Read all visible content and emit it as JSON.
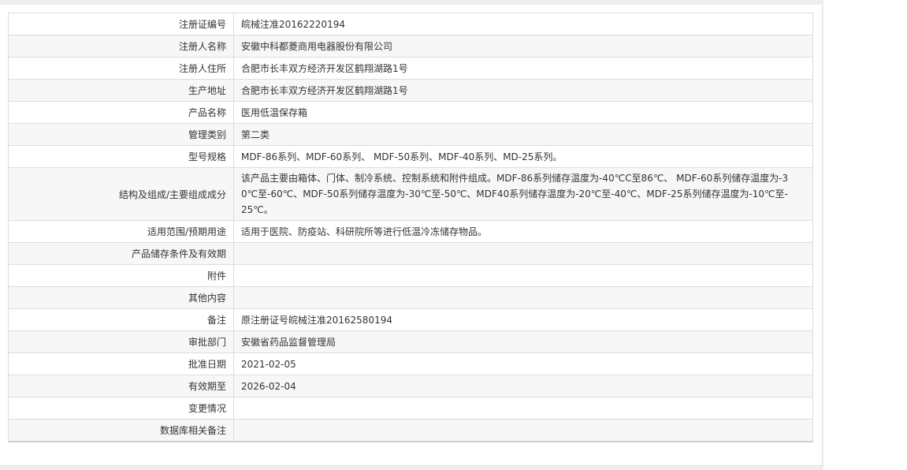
{
  "rows": [
    {
      "label": "注册证编号",
      "value": "皖械注准20162220194"
    },
    {
      "label": "注册人名称",
      "value": "安徽中科都菱商用电器股份有限公司"
    },
    {
      "label": "注册人住所",
      "value": "合肥市长丰双方经济开发区鹤翔湖路1号"
    },
    {
      "label": "生产地址",
      "value": "合肥市长丰双方经济开发区鹤翔湖路1号"
    },
    {
      "label": "产品名称",
      "value": "医用低温保存箱"
    },
    {
      "label": "管理类别",
      "value": "第二类"
    },
    {
      "label": "型号规格",
      "value": "MDF-86系列、MDF-60系列、 MDF-50系列、MDF-40系列、MD-25系列。"
    },
    {
      "label": "结构及组成/主要组成成分",
      "value": "该产品主要由箱体、门体、制冷系统、控制系统和附件组成。MDF-86系列储存温度为-40℃C至86℃、 MDF-60系列储存温度为-30℃至-60℃、MDF-50系列储存温度为-30℃至-50℃、MDF40系列储存温度为-20℃至-40℃、MDF-25系列储存温度为-10℃至-25℃。"
    },
    {
      "label": "适用范围/预期用途",
      "value": "适用于医院、防疫站、科研院所等进行低温冷冻储存物品。"
    },
    {
      "label": "产品储存条件及有效期",
      "value": ""
    },
    {
      "label": "附件",
      "value": ""
    },
    {
      "label": "其他内容",
      "value": ""
    },
    {
      "label": "备注",
      "value": "原注册证号皖械注准20162580194"
    },
    {
      "label": "审批部门",
      "value": "安徽省药品监督管理局"
    },
    {
      "label": "批准日期",
      "value": "2021-02-05"
    },
    {
      "label": "有效期至",
      "value": "2026-02-04"
    },
    {
      "label": "变更情况",
      "value": ""
    },
    {
      "label": "数据库相关备注",
      "value": ""
    }
  ]
}
